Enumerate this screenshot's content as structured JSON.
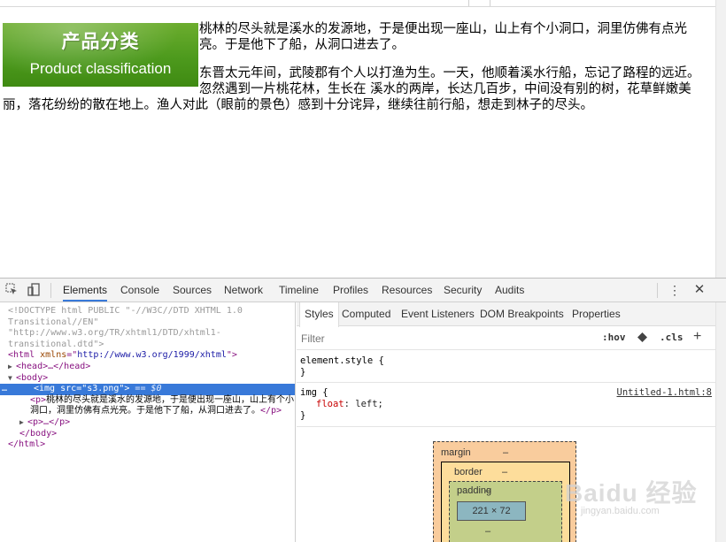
{
  "page": {
    "banner": {
      "title": "产品分类",
      "subtitle": "Product classification"
    },
    "paragraph1": "桃林的尽头就是溪水的发源地，于是便出现一座山，山上有个小洞口，洞里仿佛有点光亮。于是他下了船，从洞口进去了。",
    "paragraph2": "东晋太元年间，武陵郡有个人以打渔为生。一天，他顺着溪水行船，忘记了路程的远近。忽然遇到一片桃花林，生长在 溪水的两岸，长达几百步，中间没有别的树，花草鲜嫩美丽，落花纷纷的散在地上。渔人对此（眼前的景色）感到十分诧异，继续往前行船，想走到林子的尽头。"
  },
  "devtools": {
    "tabs": [
      "Elements",
      "Console",
      "Sources",
      "Network",
      "Timeline",
      "Profiles",
      "Resources",
      "Security",
      "Audits"
    ],
    "active_tab": "Elements",
    "dom": {
      "doctype": "<!DOCTYPE html PUBLIC \"-//W3C//DTD XHTML 1.0 Transitional//EN\" \"http://www.w3.org/TR/xhtml1/DTD/xhtml1-transitional.dtd\">",
      "html_open_tag": "<html",
      "html_attr_name": " xmlns",
      "html_attr_eq": "=\"",
      "html_attr_value": "http://www.w3.org/1999/xhtml",
      "html_attr_close": "\">",
      "head_line": "<head>…</head>",
      "body_open": "<body>",
      "img_tag_open": "<img",
      "img_attr_name": " src",
      "img_attr_eq": "=\"",
      "img_attr_value": "s3.png",
      "img_attr_close": "\">",
      "img_selected_marker": " == $0",
      "p_open": "<p>",
      "p_text": "桃林的尽头就是溪水的发源地，于是便出现一座山，山上有个小洞口，洞里仿佛有点光亮。于是他下了船，从洞口进去了。",
      "p_close": "</p>",
      "p2_line": "<p>…</p>",
      "body_close": "</body>",
      "html_close": "</html>"
    },
    "styles": {
      "subtabs": [
        "Styles",
        "Computed",
        "Event Listeners",
        "DOM Breakpoints",
        "Properties"
      ],
      "active_subtab": "Styles",
      "filter_placeholder": "Filter",
      "hov_label": ":hov",
      "cls_label": ".cls",
      "plus_label": "+",
      "rules": [
        {
          "selector": "element.style {",
          "declarations": [],
          "close": "}"
        },
        {
          "selector": "img {",
          "declarations": [
            {
              "name": "float",
              "value": "left;"
            }
          ],
          "close": "}",
          "source": "Untitled-1.html:8"
        }
      ],
      "box_model": {
        "margin_label": "margin",
        "border_label": "border",
        "padding_label": "padding",
        "dash": "–",
        "content_size": "221 × 72"
      }
    },
    "kebab_icon": "⋮",
    "close_icon": "✕"
  },
  "watermark": {
    "main": "Baidu 经验",
    "sub": "jingyan.baidu.com"
  },
  "colors": {
    "selection_blue": "#3879d9",
    "banner_green": "#4d9a1d",
    "tag_purple": "#881280",
    "attr_brown": "#994500",
    "value_blue": "#1a1aa6"
  }
}
